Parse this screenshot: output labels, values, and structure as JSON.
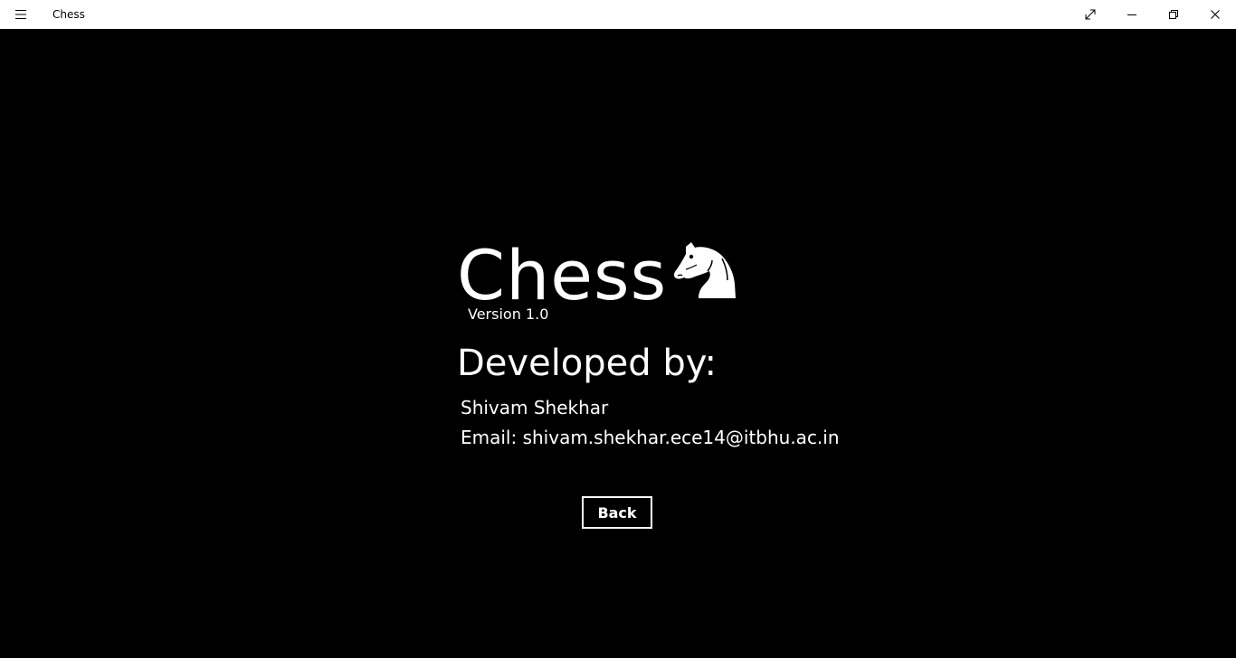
{
  "window": {
    "title": "Chess",
    "menu_icon": "hamburger-menu-icon",
    "controls": [
      "fullscreen-icon",
      "minimize-icon",
      "restore-icon",
      "close-icon"
    ]
  },
  "about": {
    "app_name": "Chess",
    "logo_icon": "chess-knight-icon",
    "version": "Version 1.0",
    "developed_by_heading": "Developed by:",
    "developer_name": "Shivam Shekhar",
    "developer_email": "Email: shivam.shekhar.ece14@itbhu.ac.in",
    "back_label": "Back"
  },
  "colors": {
    "background": "#000000",
    "foreground": "#ffffff",
    "titlebar": "#ffffff"
  }
}
